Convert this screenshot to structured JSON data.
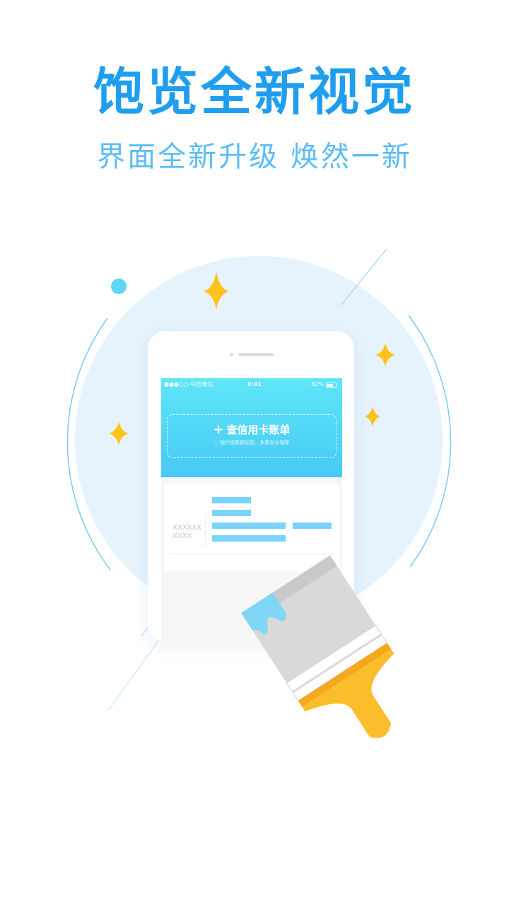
{
  "headline": {
    "title": "饱览全新视觉",
    "subtitle": "界面全新升级 焕然一新"
  },
  "phone_mockup": {
    "status_bar": {
      "carrier": "●●●○○ 中国电信",
      "time": "9:41",
      "battery": "82%"
    },
    "query_card": {
      "label": "查信用卡账单",
      "note": "银行级数据加密，多重安全保障"
    },
    "bill_card": {
      "placeholder_line1": "XXXXXX",
      "placeholder_line2": "XXXX"
    }
  },
  "colors": {
    "title": "#1f9ef0",
    "subtitle": "#5bbcf7",
    "sparkle": "#ffc21a",
    "brush_handle": "#fbbd2a",
    "brush_head": "#d8d8d8",
    "paint": "#7fd6f5",
    "circle_bg": "#e6f3fc"
  },
  "icons": [
    "sparkle-icon",
    "paint-brush-icon",
    "plus-icon",
    "shield-icon",
    "wifi-icon",
    "battery-icon"
  ]
}
